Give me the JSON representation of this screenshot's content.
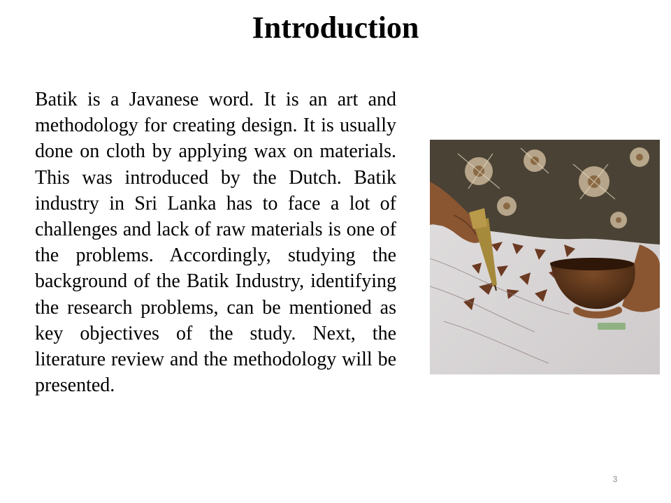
{
  "slide": {
    "title": "Introduction",
    "body": "Batik is a Javanese word. It is an art and methodology for creating design. It is usually done on cloth by applying wax on materials. This was introduced by the Dutch. Batik industry in Sri Lanka has to face a lot of challenges and lack of raw materials is one of the problems. Accordingly, studying the background of the Batik Industry, identifying the research problems, can be mentioned as key objectives of the study. Next, the literature review and the methodology will be presented.",
    "page_number": "3",
    "photo": {
      "icon": "batik-waxing-photo"
    }
  },
  "colors": {
    "background": "#ffffff",
    "text": "#000000",
    "page_number": "#8a8a8a",
    "cloth": "#dcd9da",
    "wax_motif": "#6b3a22",
    "skin": "#8a5632",
    "coconut_shell": "#5a3418",
    "shirt": "#4a4234"
  }
}
